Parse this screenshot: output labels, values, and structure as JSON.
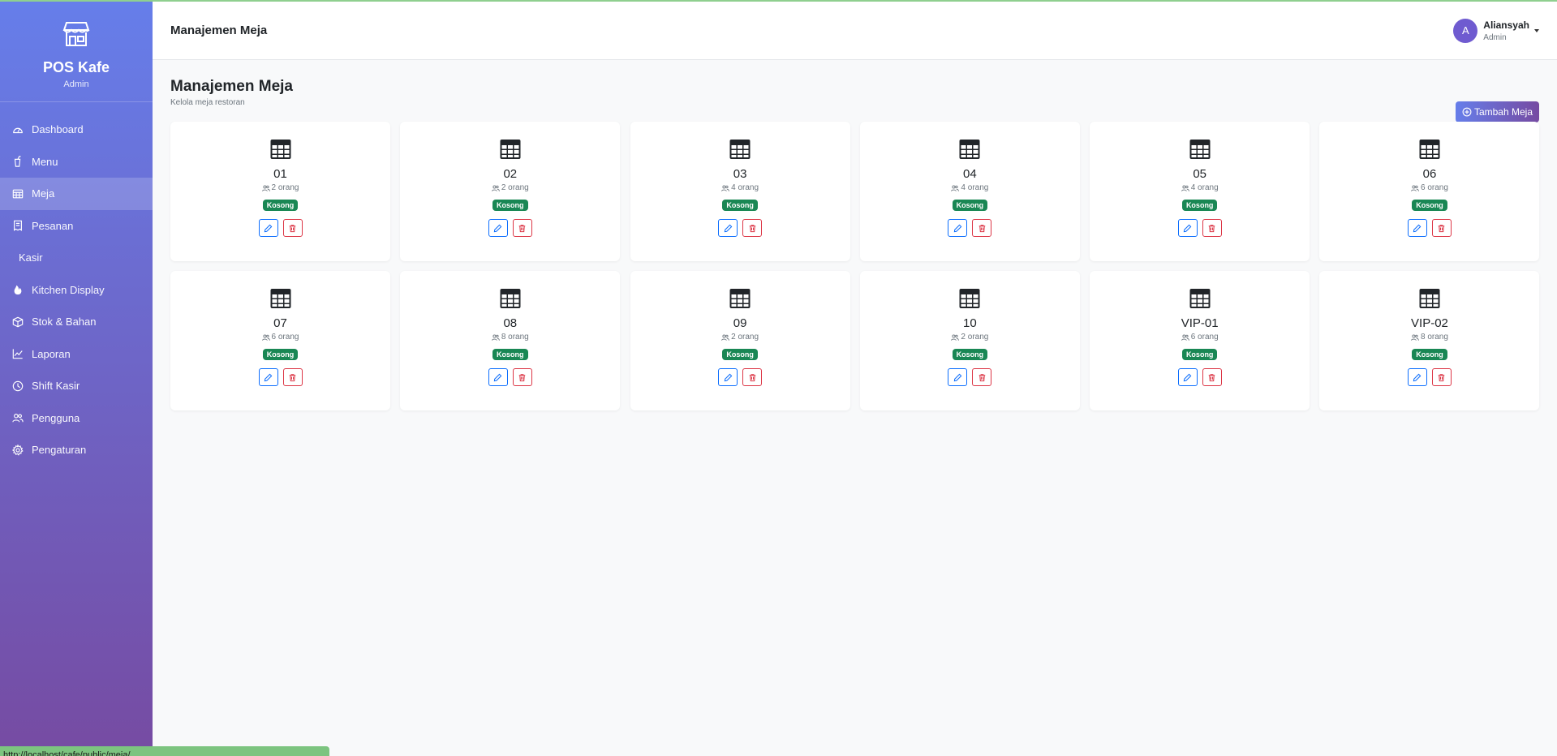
{
  "app": {
    "brand_name": "POS Kafe",
    "brand_role": "Admin"
  },
  "sidebar": {
    "items": [
      {
        "label": "Dashboard",
        "icon": "speedometer-icon",
        "active": false
      },
      {
        "label": "Menu",
        "icon": "cup-icon",
        "active": false
      },
      {
        "label": "Meja",
        "icon": "table-icon",
        "active": true
      },
      {
        "label": "Pesanan",
        "icon": "receipt-icon",
        "active": false
      },
      {
        "label": "Kasir",
        "icon": "",
        "active": false
      },
      {
        "label": "Kitchen Display",
        "icon": "fire-icon",
        "active": false
      },
      {
        "label": "Stok & Bahan",
        "icon": "box-icon",
        "active": false
      },
      {
        "label": "Laporan",
        "icon": "chart-line-icon",
        "active": false
      },
      {
        "label": "Shift Kasir",
        "icon": "clock-icon",
        "active": false
      },
      {
        "label": "Pengguna",
        "icon": "people-icon",
        "active": false
      },
      {
        "label": "Pengaturan",
        "icon": "gear-icon",
        "active": false
      }
    ]
  },
  "header": {
    "title": "Manajemen Meja",
    "user": {
      "initial": "A",
      "name": "Aliansyah",
      "role": "Admin"
    }
  },
  "page": {
    "title": "Manajemen Meja",
    "subtitle": "Kelola meja restoran",
    "add_button": "Tambah Meja"
  },
  "tables": [
    {
      "name": "01",
      "capacity": "2 orang",
      "status": "Kosong"
    },
    {
      "name": "02",
      "capacity": "2 orang",
      "status": "Kosong"
    },
    {
      "name": "03",
      "capacity": "4 orang",
      "status": "Kosong"
    },
    {
      "name": "04",
      "capacity": "4 orang",
      "status": "Kosong"
    },
    {
      "name": "05",
      "capacity": "4 orang",
      "status": "Kosong"
    },
    {
      "name": "06",
      "capacity": "6 orang",
      "status": "Kosong"
    },
    {
      "name": "07",
      "capacity": "6 orang",
      "status": "Kosong"
    },
    {
      "name": "08",
      "capacity": "8 orang",
      "status": "Kosong"
    },
    {
      "name": "09",
      "capacity": "2 orang",
      "status": "Kosong"
    },
    {
      "name": "10",
      "capacity": "2 orang",
      "status": "Kosong"
    },
    {
      "name": "VIP-01",
      "capacity": "6 orang",
      "status": "Kosong"
    },
    {
      "name": "VIP-02",
      "capacity": "8 orang",
      "status": "Kosong"
    }
  ],
  "statusbar": {
    "url": "http://localhost/cafe/public/meja/..."
  },
  "colors": {
    "sidebar_top": "#667eea",
    "sidebar_bottom": "#764ba2",
    "badge_available": "#198754",
    "edit": "#0d6efd",
    "delete": "#dc3545"
  }
}
